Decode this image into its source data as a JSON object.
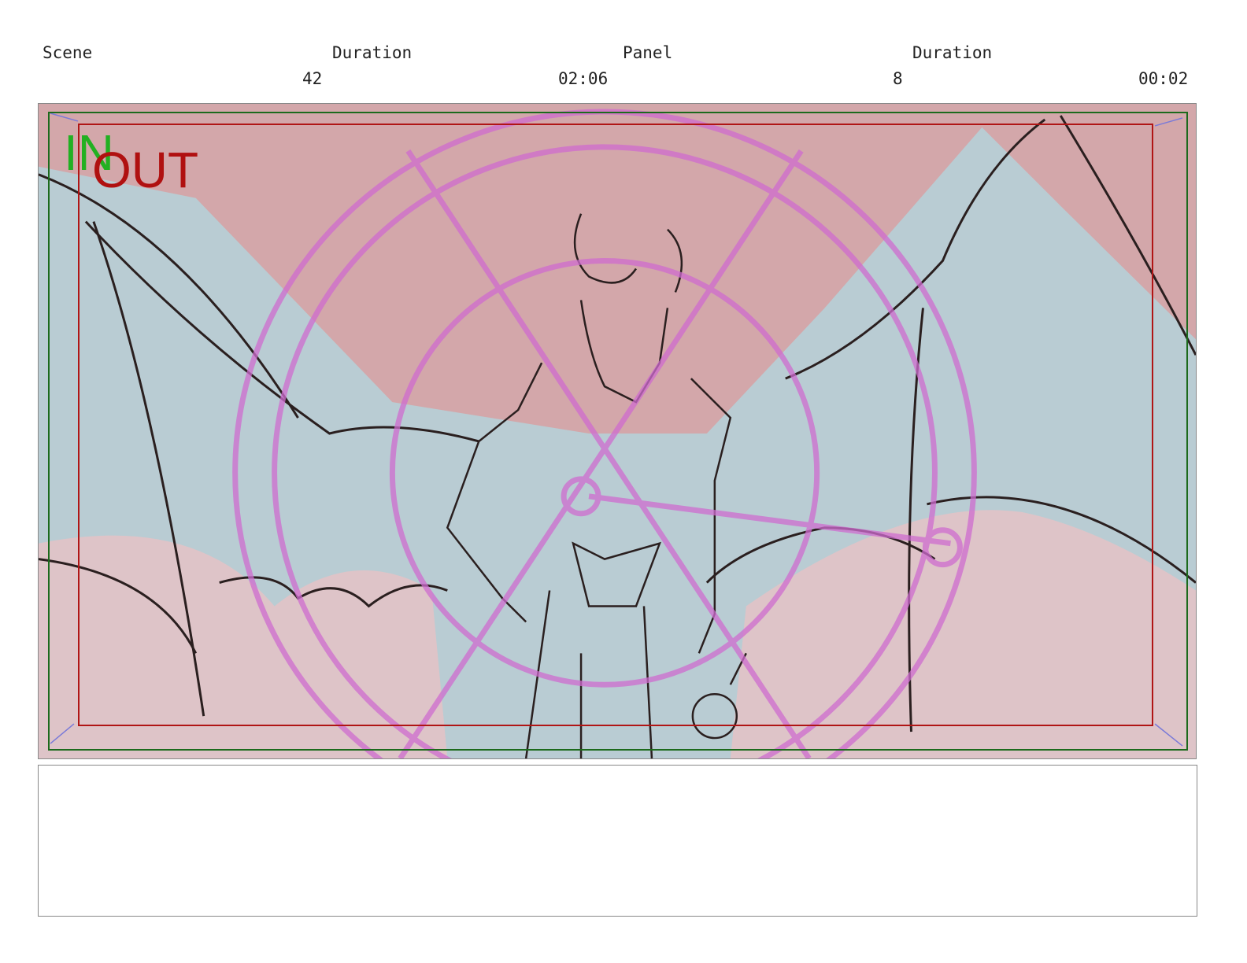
{
  "header": {
    "scene_label": "Scene",
    "scene_value": "42",
    "scene_duration_label": "Duration",
    "scene_duration_value": "02:06",
    "panel_label": "Panel",
    "panel_value": "8",
    "panel_duration_label": "Duration",
    "panel_duration_value": "00:02"
  },
  "panel": {
    "in_tag": "IN",
    "out_tag": "OUT",
    "image_subject": "demon-with-wings-magic-circle-sketch"
  },
  "notes": {
    "text": ""
  },
  "colors": {
    "safe_frame_green": "#1c6a1c",
    "safe_frame_red": "#b01515",
    "in_tag": "#22b022",
    "out_tag": "#b01010",
    "sky_pink": "#d8a2a4",
    "figure_blue": "#b6cbd2",
    "magic_circle": "#d070d0"
  }
}
